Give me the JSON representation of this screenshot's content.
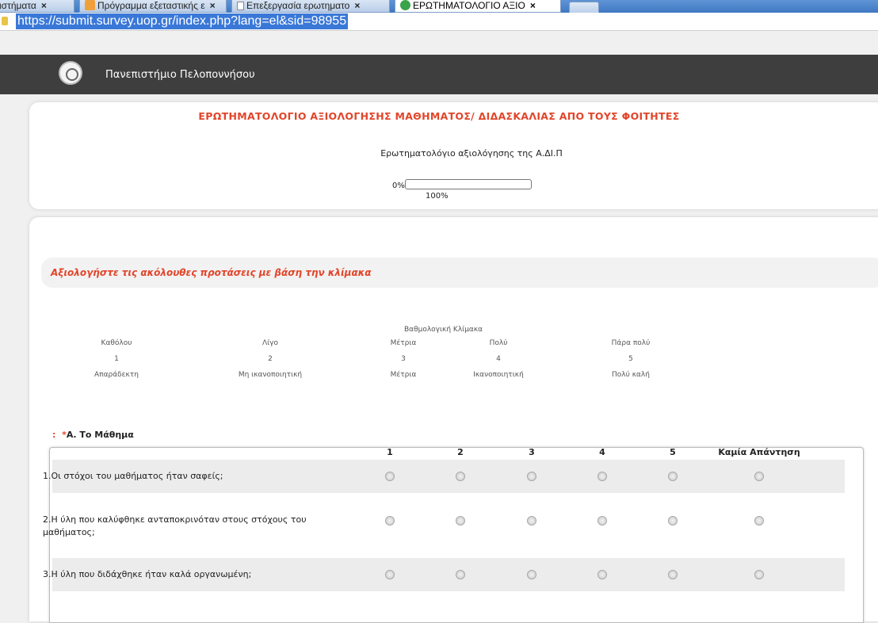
{
  "browser": {
    "tabs": [
      {
        "label": "ιστήματα",
        "active": false
      },
      {
        "label": "Πρόγραμμα εξεταστικής ε",
        "active": false
      },
      {
        "label": "Επεξεργασία ερωτηματο",
        "active": false
      },
      {
        "label": "ΕΡΩΤΗΜΑΤΟΛΟΓΙΟ ΑΞΙΟ",
        "active": true
      }
    ],
    "tab_close": "×",
    "url": "https://submit.survey.uop.gr/index.php?lang=el&sid=98955"
  },
  "site": {
    "name": "Πανεπιστήμιο Πελοποννήσου"
  },
  "survey": {
    "title": "ΕΡΩΤΗΜΑΤΟΛΟΓΙΟ ΑΞΙΟΛΟΓΗΣΗΣ ΜΑΘΗΜΑΤΟΣ/ ΔΙΔΑΣΚΑΛΙΑΣ ΑΠΟ ΤΟΥΣ ΦΟΙΤΗΤΕΣ",
    "description": "Ερωτηματολόγιο αξιολόγησης της Α.ΔΙ.Π",
    "progress_start": "0%",
    "progress_end": "100%",
    "progress_fraction": 0
  },
  "group": {
    "title": "Αξιολογήστε τις ακόλουθες προτάσεις με βάση την κλίμακα"
  },
  "scale": {
    "title": "Βαθμολογική Κλίμακα",
    "columns": [
      {
        "name": "Καθόλου",
        "number": "1",
        "desc": "Απαράδεκτη"
      },
      {
        "name": "Λίγο",
        "number": "2",
        "desc": "Μη ικανοποιητική"
      },
      {
        "name": "Μέτρια",
        "number": "3",
        "desc": "Μέτρια"
      },
      {
        "name": "Πολύ",
        "number": "4",
        "desc": "Ικανοποιητική"
      },
      {
        "name": "Πάρα πολύ",
        "number": "5",
        "desc": "Πολύ καλή"
      }
    ]
  },
  "question": {
    "prefix": ":",
    "star": "*",
    "title": "Α. Το Μάθημα",
    "columns": [
      "1",
      "2",
      "3",
      "4",
      "5",
      "Καμία Απάντηση"
    ],
    "rows": [
      "1.Οι στόχοι του μαθήματος ήταν σαφείς;",
      "2.Η ύλη που καλύφθηκε ανταποκρινόταν στους στόχους του μαθήματος;",
      "3.Η ύλη που διδάχθηκε ήταν καλά οργανωμένη;"
    ]
  }
}
